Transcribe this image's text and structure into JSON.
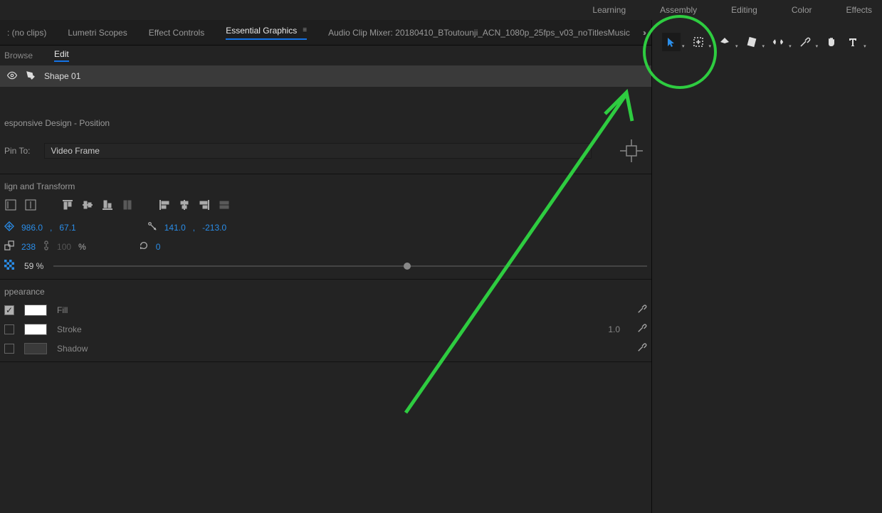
{
  "workspaces": [
    "Learning",
    "Assembly",
    "Editing",
    "Color",
    "Effects"
  ],
  "panels": {
    "source": ": (no clips)",
    "lumetri": "Lumetri Scopes",
    "effect": "Effect Controls",
    "essential": "Essential Graphics",
    "audio": "Audio Clip Mixer: 20180410_BToutounji_ACN_1080p_25fps_v03_noTitlesMusic"
  },
  "subtabs": {
    "browse": "Browse",
    "edit": "Edit"
  },
  "layer": {
    "name": "Shape 01"
  },
  "responsive": {
    "header": "esponsive Design - Position",
    "pinLabel": "Pin To:",
    "pinValue": "Video Frame"
  },
  "align": {
    "header": "lign and Transform",
    "pos": {
      "x": "986.0",
      "y": "67.1"
    },
    "anchor": {
      "x": "141.0",
      "y": "-213.0"
    },
    "scale": {
      "val": "238",
      "locked": "100",
      "unit": "%"
    },
    "rotation": "0",
    "opacity": "59 %"
  },
  "appearance": {
    "header": "ppearance",
    "fill": "Fill",
    "stroke": "Stroke",
    "strokeVal": "1.0",
    "shadow": "Shadow"
  }
}
